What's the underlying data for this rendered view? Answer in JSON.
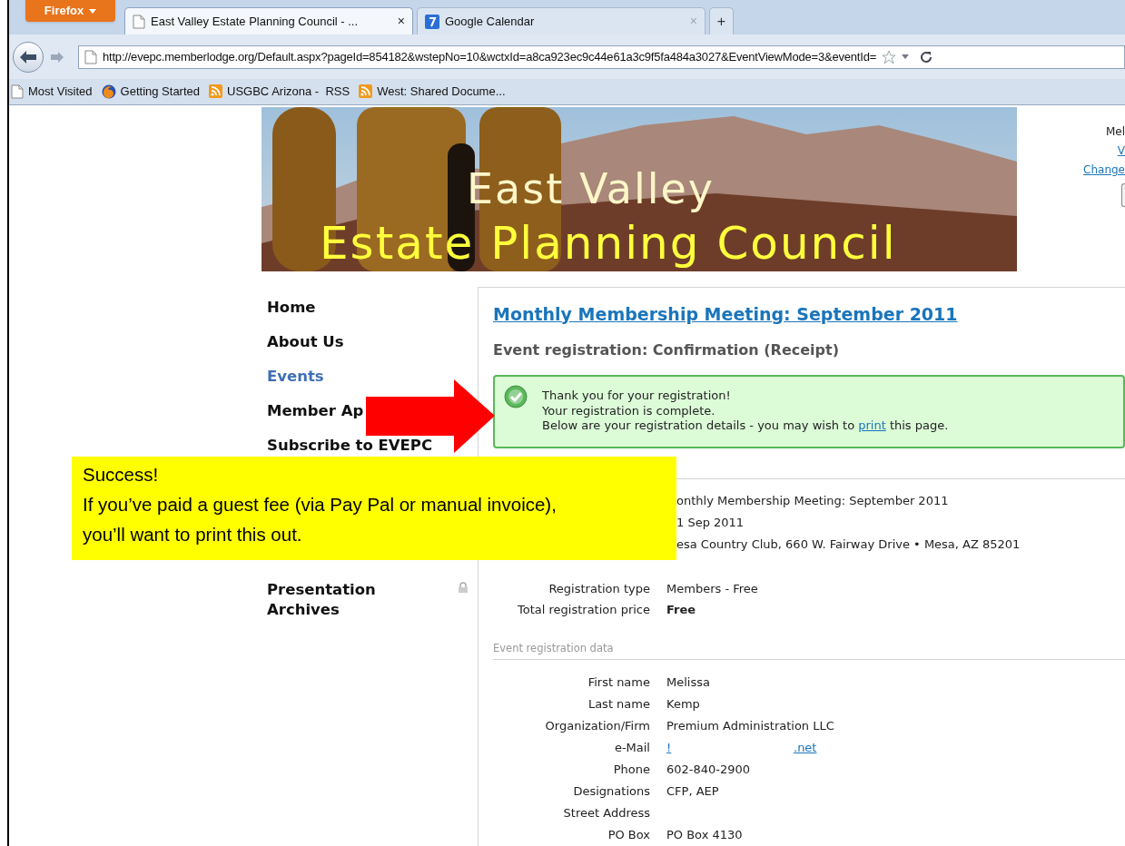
{
  "browser": {
    "menu_button": "Firefox",
    "tabs": [
      {
        "title": "East Valley Estate Planning Council - ...",
        "close": "×",
        "selected": true,
        "kind": "page"
      },
      {
        "title": "Google Calendar",
        "close": "×",
        "selected": false,
        "kind": "calendar"
      }
    ],
    "new_tab": "+",
    "url": "http://evepc.memberlodge.org/Default.aspx?pageId=854182&wstepNo=10&wctxId=a8ca923ec9c44e61a3c9f5fa484a3027&EventViewMode=3&eventId=",
    "bookmarks": [
      {
        "label": "Most Visited",
        "kind": "page"
      },
      {
        "label": "Getting Started",
        "kind": "firefox"
      },
      {
        "label": "USGBC Arizona -  RSS",
        "kind": "rss"
      },
      {
        "label": "West: Shared Docume...",
        "kind": "rss"
      }
    ]
  },
  "banner": {
    "line_1": "East Valley",
    "line_2": "Estate Planning Council"
  },
  "account": {
    "greeting": "Mel",
    "link_1": "V",
    "link_2": "Change"
  },
  "menu": [
    {
      "label": "Home",
      "selected": false,
      "locked": false
    },
    {
      "label": "About Us",
      "selected": false,
      "locked": false
    },
    {
      "label": "Events",
      "selected": true,
      "locked": false
    },
    {
      "label": "Member Ap",
      "selected": false,
      "locked": false
    },
    {
      "label": "Subscribe to EVEPC",
      "selected": false,
      "locked": false
    },
    {
      "label": "Presentation Archives",
      "selected": false,
      "locked": true
    }
  ],
  "event": {
    "title": "Monthly Membership Meeting: September 2011",
    "subtitle": "Event registration: Confirmation (Receipt)",
    "notice": {
      "lines": [
        "Thank you for your registration!",
        "Your registration is complete."
      ],
      "before_link": "Below are your registration details - you may wish to",
      "link": "print",
      "after_link": "this page."
    },
    "details": [
      "onthly Membership Meeting: September 2011",
      "1 Sep 2011",
      "esa Country Club, 660 W. Fairway Drive • Mesa, AZ 85201"
    ],
    "summary": [
      {
        "label": "Registration type",
        "value": "Members - Free",
        "emphasis": false
      },
      {
        "label": "Total registration price",
        "value": "Free",
        "emphasis": true
      }
    ],
    "data_heading": "Event registration data",
    "fields": [
      {
        "label": "First name",
        "value": "Melissa",
        "kind": "text"
      },
      {
        "label": "Last name",
        "value": "Kemp",
        "kind": "text"
      },
      {
        "label": "Organization/Firm",
        "value": "Premium Administration LLC",
        "kind": "text"
      },
      {
        "label": "e-Mail",
        "parts": [
          "!",
          ".net"
        ],
        "kind": "email"
      },
      {
        "label": "Phone",
        "value": "602-840-2900",
        "kind": "text"
      },
      {
        "label": "Designations",
        "value": "CFP, AEP",
        "kind": "text"
      },
      {
        "label": "Street Address",
        "kind": "empty"
      },
      {
        "label": "PO Box",
        "value": "PO Box 4130",
        "kind": "text"
      }
    ]
  },
  "callout": {
    "lines": [
      "Success!",
      "If you’ve paid a guest fee (via Pay Pal or manual invoice),",
      "you’ll want to print this out."
    ]
  }
}
